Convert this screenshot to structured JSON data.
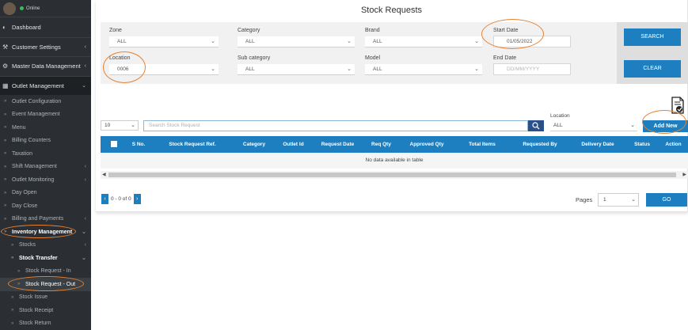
{
  "sidebar": {
    "status": "Online",
    "items": [
      {
        "label": "Dashboard",
        "icon": "dashboard-icon"
      },
      {
        "label": "Customer Settings",
        "icon": "wrench-icon"
      },
      {
        "label": "Master Data Management",
        "icon": "gear-icon"
      },
      {
        "label": "Outlet Management",
        "icon": "outlet-icon"
      }
    ],
    "outlet_children": [
      "Outlet Configuration",
      "Event Management",
      "Menu",
      "Billing Counters",
      "Taxation",
      "Shift Management",
      "Outlet Monitoring",
      "Day Open",
      "Day Close",
      "Billing and Payments",
      "Inventory Management"
    ],
    "inventory_children": [
      "Stocks",
      "Stock Transfer"
    ],
    "transfer_children": [
      "Stock Request - In",
      "Stock Request - Out"
    ],
    "inventory_more": [
      "Stock Issue",
      "Stock Receipt",
      "Stock Return"
    ]
  },
  "page": {
    "title": "Stock Requests"
  },
  "filters": {
    "zone": {
      "label": "Zone",
      "value": "ALL"
    },
    "category": {
      "label": "Category",
      "value": "ALL"
    },
    "brand": {
      "label": "Brand",
      "value": "ALL"
    },
    "start_date": {
      "label": "Start Date",
      "value": "01/05/2022"
    },
    "location": {
      "label": "Location",
      "value": "0006"
    },
    "sub_category": {
      "label": "Sub category",
      "value": "ALL"
    },
    "model": {
      "label": "Model",
      "value": "ALL"
    },
    "end_date": {
      "label": "End Date",
      "placeholder": "DD/MM/YYYY"
    },
    "search_label": "SEARCH",
    "clear_label": "CLEAR"
  },
  "table_controls": {
    "page_size": "10",
    "search_placeholder": "Search Stock Request",
    "location_label": "Location",
    "location_value": "ALL",
    "add_new_label": "Add New"
  },
  "table": {
    "columns": [
      "S No.",
      "Stock Request Ref.",
      "Category",
      "Outlet Id",
      "Request Date",
      "Req Qty",
      "Approved Qty",
      "Total Items",
      "Requested By",
      "Delivery Date",
      "Status",
      "Action"
    ],
    "empty_message": "No data available in table"
  },
  "pager": {
    "info": "0 - 0 of 0",
    "pages_label": "Pages",
    "page_value": "1",
    "go_label": "GO"
  },
  "colors": {
    "primary": "#1e7fc0",
    "sidebar_bg": "#2b2f33",
    "annotation": "#e8822f"
  }
}
